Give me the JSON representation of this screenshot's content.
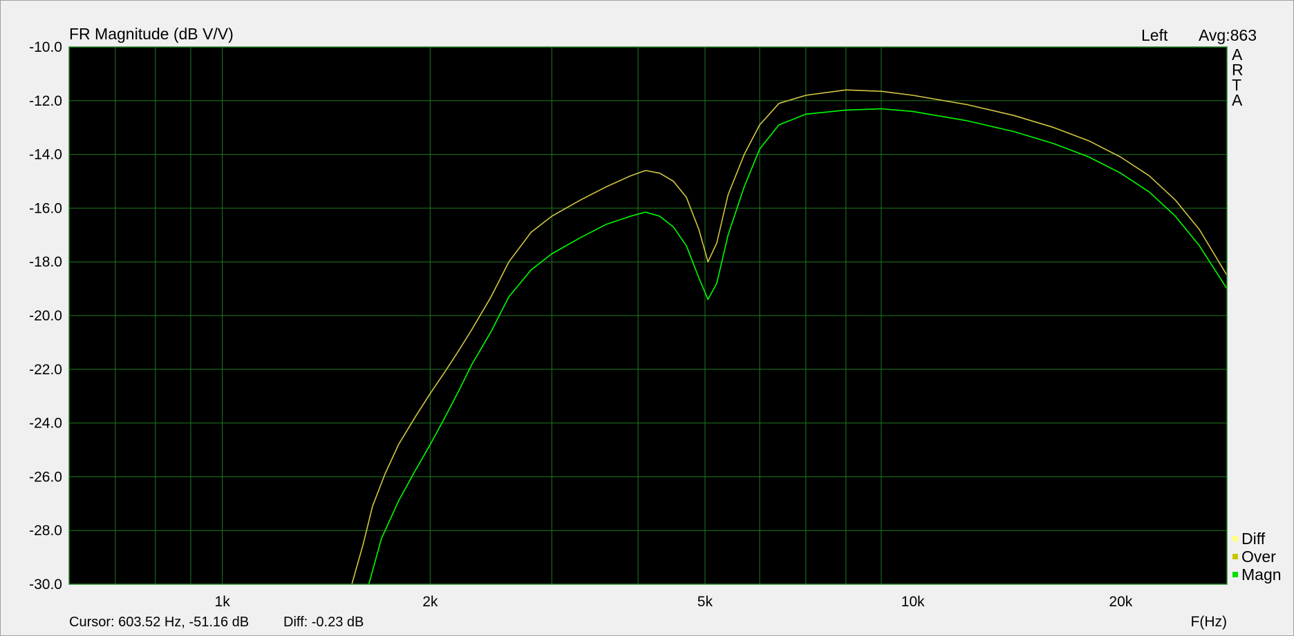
{
  "window": {
    "background": "#f0f0f0",
    "plot_background": "#000000",
    "grid_color": "#1f7a1f"
  },
  "header": {
    "title": "FR Magnitude (dB V/V)",
    "channel": "Left",
    "avg": "Avg:863"
  },
  "brand_letters": [
    "A",
    "R",
    "T",
    "A"
  ],
  "status": {
    "cursor": "Cursor: 603.52 Hz, -51.16 dB",
    "diff": "Diff: -0.23 dB"
  },
  "legend": [
    {
      "label": "Diff",
      "color": "#ffff80"
    },
    {
      "label": "Over",
      "color": "#c8c800"
    },
    {
      "label": "Magn",
      "color": "#00e000"
    }
  ],
  "chart_data": {
    "type": "line",
    "title": "FR Magnitude (dB V/V)",
    "xlabel": "F(Hz)",
    "ylabel": "",
    "x_scale": "log",
    "xlim": [
      600,
      28500
    ],
    "ylim": [
      -30,
      -10
    ],
    "grid": true,
    "legend_position": "bottom-right",
    "x_ticks": [
      {
        "value": 1000,
        "label": "1k"
      },
      {
        "value": 2000,
        "label": "2k"
      },
      {
        "value": 5000,
        "label": "5k"
      },
      {
        "value": 10000,
        "label": "10k"
      },
      {
        "value": 20000,
        "label": "20k"
      }
    ],
    "y_ticks": [
      {
        "value": -10,
        "label": "-10.0"
      },
      {
        "value": -12,
        "label": "-12.0"
      },
      {
        "value": -14,
        "label": "-14.0"
      },
      {
        "value": -16,
        "label": "-16.0"
      },
      {
        "value": -18,
        "label": "-18.0"
      },
      {
        "value": -20,
        "label": "-20.0"
      },
      {
        "value": -22,
        "label": "-22.0"
      },
      {
        "value": -24,
        "label": "-24.0"
      },
      {
        "value": -26,
        "label": "-26.0"
      },
      {
        "value": -28,
        "label": "-28.0"
      },
      {
        "value": -30,
        "label": "-30.0"
      }
    ],
    "series": [
      {
        "name": "Over",
        "color": "#d4c840",
        "x": [
          1540,
          1600,
          1650,
          1720,
          1800,
          1900,
          2000,
          2100,
          2200,
          2300,
          2450,
          2600,
          2800,
          3000,
          3300,
          3600,
          3900,
          4100,
          4300,
          4500,
          4700,
          4900,
          5050,
          5200,
          5400,
          5700,
          6000,
          6400,
          7000,
          8000,
          9000,
          10000,
          12000,
          14000,
          16000,
          18000,
          20000,
          22000,
          24000,
          26000,
          28500
        ],
        "y": [
          -30.0,
          -28.5,
          -27.1,
          -25.9,
          -24.8,
          -23.8,
          -22.9,
          -22.1,
          -21.3,
          -20.5,
          -19.3,
          -18.0,
          -16.9,
          -16.3,
          -15.7,
          -15.2,
          -14.8,
          -14.6,
          -14.7,
          -15.0,
          -15.6,
          -16.8,
          -18.0,
          -17.3,
          -15.5,
          -14.0,
          -12.9,
          -12.1,
          -11.8,
          -11.6,
          -11.65,
          -11.8,
          -12.15,
          -12.55,
          -13.0,
          -13.5,
          -14.1,
          -14.8,
          -15.7,
          -16.8,
          -18.5
        ]
      },
      {
        "name": "Magn",
        "color": "#00ff00",
        "x": [
          1630,
          1700,
          1800,
          1900,
          2000,
          2100,
          2200,
          2300,
          2450,
          2600,
          2800,
          3000,
          3300,
          3600,
          3900,
          4100,
          4300,
          4500,
          4700,
          4900,
          5050,
          5200,
          5400,
          5700,
          6000,
          6400,
          7000,
          8000,
          9000,
          10000,
          12000,
          14000,
          16000,
          18000,
          20000,
          22000,
          24000,
          26000,
          28500
        ],
        "y": [
          -30.0,
          -28.3,
          -26.9,
          -25.8,
          -24.8,
          -23.8,
          -22.8,
          -21.8,
          -20.6,
          -19.3,
          -18.3,
          -17.7,
          -17.1,
          -16.6,
          -16.3,
          -16.15,
          -16.3,
          -16.7,
          -17.4,
          -18.6,
          -19.4,
          -18.8,
          -17.0,
          -15.2,
          -13.8,
          -12.9,
          -12.5,
          -12.35,
          -12.3,
          -12.4,
          -12.75,
          -13.15,
          -13.6,
          -14.1,
          -14.7,
          -15.4,
          -16.3,
          -17.4,
          -19.0
        ]
      }
    ]
  }
}
